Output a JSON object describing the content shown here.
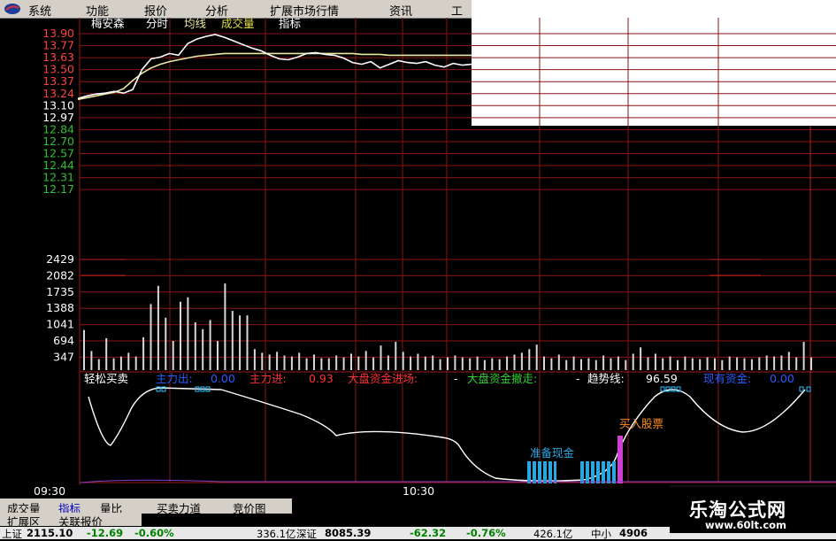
{
  "menu": {
    "items": [
      "系统",
      "功能",
      "报价",
      "分析",
      "扩展市场行情",
      "资讯",
      "工"
    ]
  },
  "chart_header": {
    "stock_name": "梅安森",
    "modes": [
      "分时",
      "均线",
      "成交量",
      "指标"
    ]
  },
  "price_axis": [
    "13.90",
    "13.77",
    "13.63",
    "13.50",
    "13.37",
    "13.24",
    "13.10",
    "12.97",
    "12.84",
    "12.70",
    "12.57",
    "12.44",
    "12.31",
    "12.17"
  ],
  "volume_axis": [
    "2429",
    "2082",
    "1735",
    "1388",
    "1041",
    "694",
    "347"
  ],
  "indicator_bar": {
    "name": "轻松买卖",
    "zhulichu_label": "主力出:",
    "zhulichu_value": "0.00",
    "zhulijin_label": "主力进:",
    "zhulijin_value": "0.93",
    "dapan_in_label": "大盘资金进场:",
    "dapan_in_value": "-",
    "dapan_out_label": "大盘资金撤走:",
    "dapan_out_value": "-",
    "trend_label": "趋势线:",
    "trend_value": "96.59",
    "fund_label": "现有资金:",
    "fund_value": "0.00"
  },
  "annotations": {
    "prepare_cash": "准备现金",
    "buy_stock": "买入股票"
  },
  "time_axis": {
    "start": "09:30",
    "mid": "10:30"
  },
  "tabs_row1": [
    "成交量",
    "指标",
    "量比",
    "买卖力道",
    "竞价图"
  ],
  "tabs_row2": [
    "扩展区",
    "关联报价"
  ],
  "status": {
    "sh_label": "上证",
    "sh_value": "2115.10",
    "sh_change": "-12.69",
    "sh_pct": "-0.60%",
    "sh_amount": "336.1亿",
    "sz_label": "深证",
    "sz_value": "8085.39",
    "sz_change": "-62.32",
    "sz_pct": "-0.76%",
    "sz_amount": "426.1亿",
    "zx_label": "中小",
    "zx_value": "4906"
  },
  "watermark": {
    "title": "乐淘公式网",
    "url": "www.60lt.com"
  },
  "colors": {
    "grid_red": "#a01818",
    "price_axis_red": "#ff4040",
    "price_axis_green": "#30c030",
    "price_line": "#ffffff",
    "avg_line": "#e8e8a0",
    "cyan_bars": "#2aa6e0",
    "magenta_bar": "#d040d0"
  },
  "chart_data": [
    {
      "type": "line",
      "name": "intraday-price",
      "ylim": [
        12.17,
        13.97
      ],
      "y_ticks": [
        13.9,
        13.77,
        13.63,
        13.5,
        13.37,
        13.24,
        13.1,
        12.97,
        12.84,
        12.7,
        12.57,
        12.44,
        12.31,
        12.17
      ],
      "series": [
        {
          "values": [
            13.18,
            13.21,
            13.23,
            13.24,
            13.26,
            13.24,
            13.28,
            13.5,
            13.62,
            13.64,
            13.68,
            13.66,
            13.79,
            13.84,
            13.87,
            13.89,
            13.86,
            13.82,
            13.78,
            13.74,
            13.71,
            13.66,
            13.62,
            13.61,
            13.64,
            13.68,
            13.69,
            13.67,
            13.66,
            13.63,
            13.58,
            13.56,
            13.59,
            13.52,
            13.56,
            13.6,
            13.58,
            13.57,
            13.59,
            13.55,
            13.53,
            13.57,
            13.55,
            13.56
          ]
        },
        {
          "values": [
            13.17,
            13.19,
            13.21,
            13.23,
            13.25,
            13.29,
            13.38,
            13.46,
            13.52,
            13.56,
            13.59,
            13.61,
            13.63,
            13.65,
            13.66,
            13.67,
            13.68,
            13.68,
            13.68,
            13.68,
            13.68,
            13.68,
            13.68,
            13.68,
            13.68,
            13.68,
            13.68,
            13.68,
            13.68,
            13.68,
            13.68,
            13.67,
            13.67,
            13.67,
            13.66,
            13.66,
            13.66,
            13.66,
            13.66,
            13.66,
            13.66,
            13.66,
            13.66,
            13.66
          ]
        }
      ]
    },
    {
      "type": "bar",
      "name": "intraday-volume",
      "ylim": [
        0,
        2429
      ],
      "values": [
        880,
        420,
        240,
        700,
        260,
        300,
        380,
        300,
        720,
        1450,
        1850,
        1150,
        640,
        1500,
        1600,
        1050,
        900,
        1100,
        640,
        1900,
        1300,
        1200,
        1200,
        460,
        380,
        340,
        400,
        320,
        300,
        380,
        260,
        340,
        260,
        260,
        320,
        280,
        360,
        300,
        420,
        280,
        540,
        320,
        620,
        400,
        300,
        360,
        300,
        320,
        240,
        280,
        320,
        280,
        260,
        300,
        220,
        260,
        240,
        300,
        340,
        380,
        460,
        560,
        300,
        260,
        340,
        220,
        300,
        240,
        260,
        220,
        320,
        260,
        300,
        220,
        360,
        500,
        280,
        360,
        260,
        300,
        220,
        300,
        260,
        240,
        280,
        260,
        220,
        300,
        280,
        260,
        240,
        280,
        320,
        300,
        320,
        400,
        280,
        620,
        280
      ]
    }
  ]
}
